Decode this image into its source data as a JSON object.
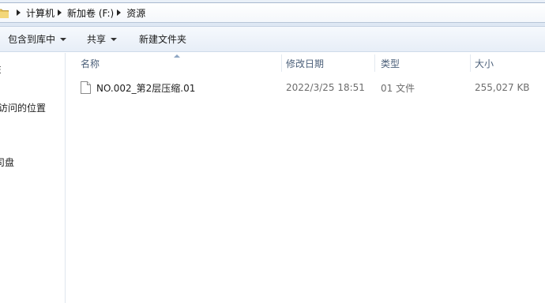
{
  "window": {
    "accent": "#dde7f3"
  },
  "breadcrumb": {
    "items": [
      "计算机",
      "新加卷 (F:)",
      "资源"
    ]
  },
  "toolbar": {
    "organize_label": "包含到库中",
    "share_label": "共享",
    "new_folder_label": "新建文件夹"
  },
  "sidebar": {
    "items": [
      {
        "label": "E"
      },
      {
        "label": "访问的位置"
      },
      {
        "label": "司盘"
      }
    ]
  },
  "columns": {
    "name": "名称",
    "modified": "修改日期",
    "type": "类型",
    "size": "大小"
  },
  "files": [
    {
      "name": "NO.002_第2层压缩.01",
      "modified": "2022/3/25 18:51",
      "type": "01 文件",
      "size": "255,027 KB",
      "icon": "file-icon"
    }
  ]
}
